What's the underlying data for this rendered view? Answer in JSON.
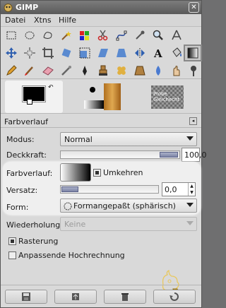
{
  "window": {
    "title": "GIMP",
    "close_glyph": "✕"
  },
  "menu": {
    "items": [
      "Datei",
      "Xtns",
      "Hilfe"
    ]
  },
  "tools": [
    {
      "name": "rect-select-icon"
    },
    {
      "name": "ellipse-select-icon"
    },
    {
      "name": "free-select-icon"
    },
    {
      "name": "fuzzy-select-icon"
    },
    {
      "name": "select-by-color-icon"
    },
    {
      "name": "scissors-icon"
    },
    {
      "name": "paths-icon"
    },
    {
      "name": "color-picker-icon"
    },
    {
      "name": "magnify-icon"
    },
    {
      "name": "measure-icon"
    },
    {
      "name": "move-icon"
    },
    {
      "name": "align-icon"
    },
    {
      "name": "crop-icon"
    },
    {
      "name": "rotate-icon"
    },
    {
      "name": "scale-icon"
    },
    {
      "name": "shear-icon"
    },
    {
      "name": "perspective-icon"
    },
    {
      "name": "flip-icon"
    },
    {
      "name": "text-icon"
    },
    {
      "name": "bucket-fill-icon"
    },
    {
      "name": "blend-icon"
    },
    {
      "name": "pencil-icon"
    },
    {
      "name": "paintbrush-icon"
    },
    {
      "name": "eraser-icon"
    },
    {
      "name": "airbrush-icon"
    },
    {
      "name": "ink-icon"
    },
    {
      "name": "clone-icon"
    },
    {
      "name": "heal-icon"
    },
    {
      "name": "perspective-clone-icon"
    },
    {
      "name": "blur-icon"
    },
    {
      "name": "smudge-icon"
    },
    {
      "name": "dodge-burn-icon"
    }
  ],
  "swatch": {
    "pattern_label_1": "Probe",
    "pattern_label_2": "Gleichecht"
  },
  "options": {
    "title": "Farbverlauf",
    "modus_label": "Modus:",
    "modus_value": "Normal",
    "deckkraft_label": "Deckkraft:",
    "deckkraft_value": "100,0",
    "deckkraft_level": 1.0,
    "farbverlauf_label": "Farbverlauf:",
    "umkehren_label": "Umkehren",
    "umkehren_checked": true,
    "versatz_label": "Versatz:",
    "versatz_value": "0,0",
    "versatz_level": 0.0,
    "form_label": "Form:",
    "form_value": "Formangepaßt (sphärisch)",
    "wiederholung_label": "Wiederholung:",
    "wiederholung_value": "Keine",
    "rasterung_label": "Rasterung",
    "rasterung_checked": true,
    "anpassende_label": "Anpassende Hochrechnung",
    "anpassende_checked": false
  },
  "bottom_buttons": [
    "save-button",
    "restore-button",
    "delete-button"
  ]
}
